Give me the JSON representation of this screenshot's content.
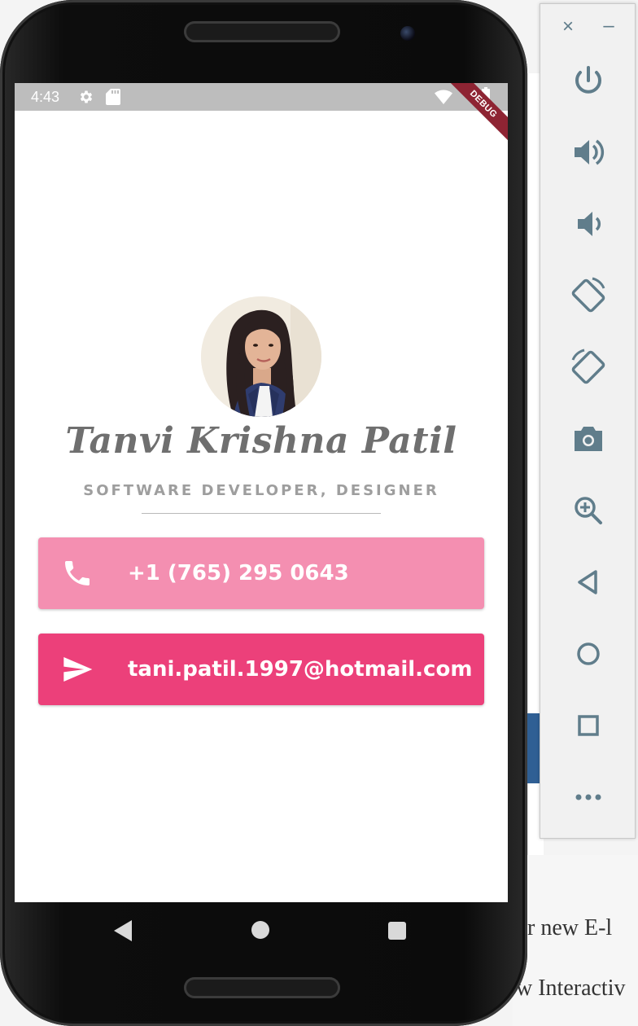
{
  "status_bar": {
    "time": "4:43"
  },
  "debug_banner": "DEBUG",
  "profile": {
    "name": "Tanvi Krishna Patil",
    "title": "SOFTWARE DEVELOPER, DESIGNER"
  },
  "contacts": {
    "phone": "+1 (765) 295 0643",
    "email": "tani.patil.1997@hotmail.com"
  },
  "colors": {
    "phone_card": "#f48fb1",
    "email_card": "#ec407a",
    "name_text": "#6f6f6f",
    "title_text": "#9e9e9e",
    "toolbar_icon": "#607d8b"
  },
  "emulator_toolbar": {
    "close": "×",
    "minimize": "–",
    "buttons": [
      "power-icon",
      "volume-up-icon",
      "volume-down-icon",
      "rotate-left-icon",
      "rotate-right-icon",
      "camera-icon",
      "zoom-icon",
      "back-icon",
      "home-icon",
      "overview-icon",
      "more-icon"
    ]
  },
  "background_window": {
    "line1": "ur new E-l",
    "line2": "w Interactiv"
  }
}
